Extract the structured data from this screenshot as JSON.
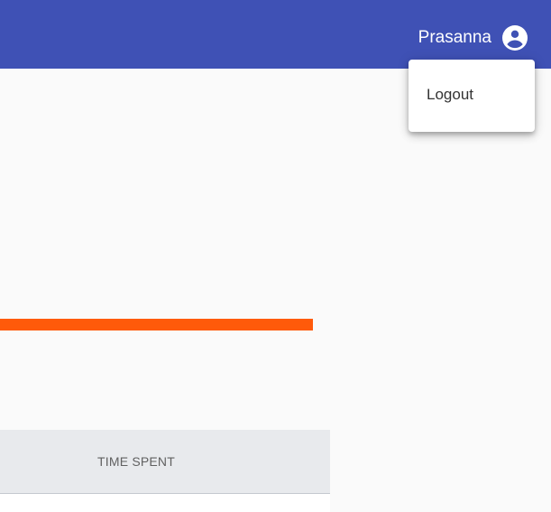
{
  "header": {
    "user_name": "Prasanna",
    "user_icon": "account-circle-icon",
    "background_color": "#3f51b5"
  },
  "user_menu": {
    "items": [
      {
        "label": "Logout"
      }
    ]
  },
  "progress": {
    "color": "#ff5a0a"
  },
  "table": {
    "columns": [
      {
        "label": "TIME SPENT"
      }
    ]
  }
}
